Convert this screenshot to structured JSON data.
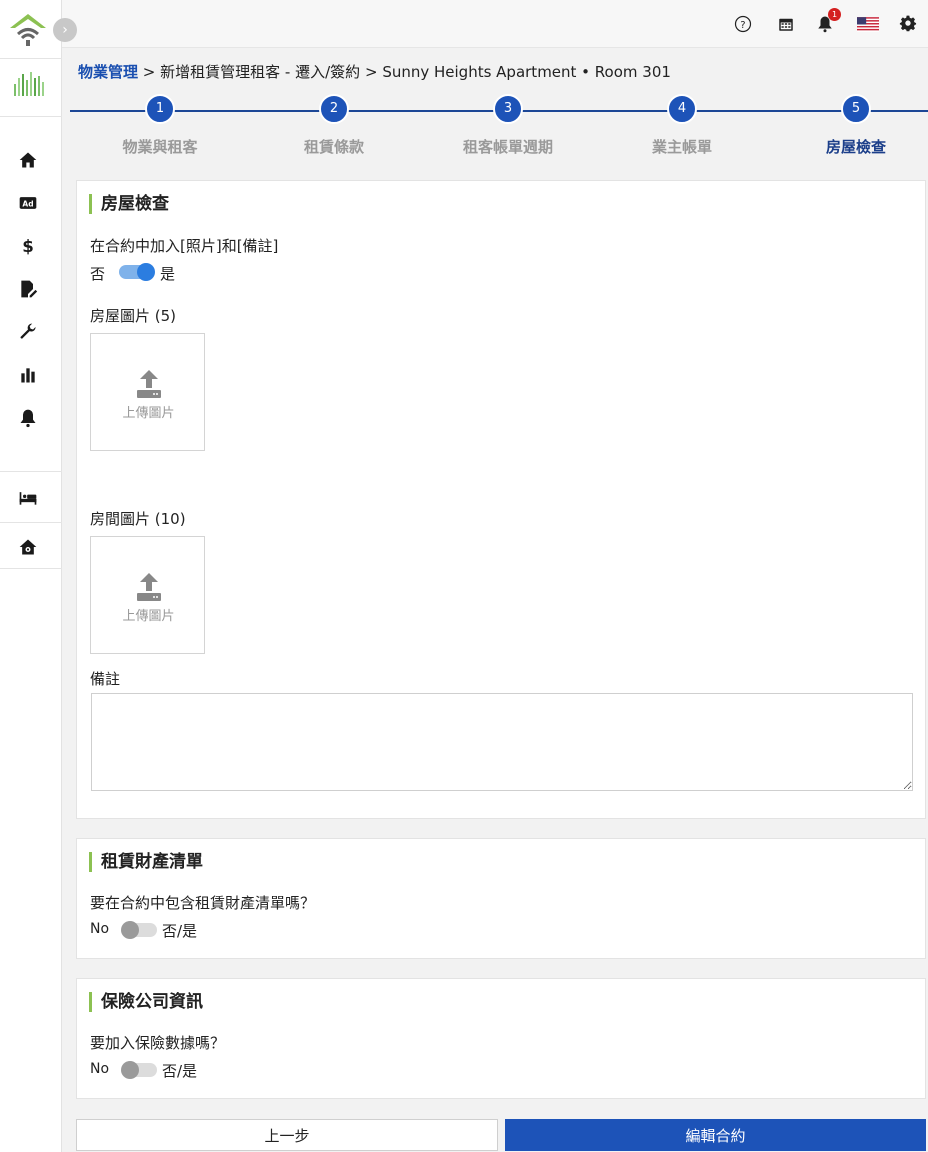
{
  "breadcrumb": {
    "root": "物業管理",
    "sep": ">",
    "step1": "新增租賃管理租客 - 遷入/簽約",
    "property": "Sunny Heights Apartment • Room 301"
  },
  "topbar": {
    "notification_count": "1"
  },
  "steps": [
    {
      "num": "1",
      "label": "物業與租客"
    },
    {
      "num": "2",
      "label": "租賃條款"
    },
    {
      "num": "3",
      "label": "租客帳單週期"
    },
    {
      "num": "4",
      "label": "業主帳單"
    },
    {
      "num": "5",
      "label": "房屋檢查"
    }
  ],
  "inspection": {
    "title": "房屋檢查",
    "include_label": "在合約中加入[照片]和[備註]",
    "no": "否",
    "yes": "是",
    "house_photos_label": "房屋圖片 (5)",
    "room_photos_label": "房間圖片 (10)",
    "upload_label": "上傳圖片",
    "notes_label": "備註"
  },
  "inventory": {
    "title": "租賃財產清單",
    "question": "要在合約中包含租賃財產清單嗎？",
    "state": "No",
    "option": "否/是"
  },
  "insurance": {
    "title": "保險公司資訊",
    "question": "要加入保險數據嗎？",
    "state": "No",
    "option": "否/是"
  },
  "buttons": {
    "prev": "上一步",
    "edit": "編輯合約"
  },
  "colors": {
    "primary": "#1d53b8",
    "accent_green": "#8cc152",
    "badge": "#d42020"
  }
}
